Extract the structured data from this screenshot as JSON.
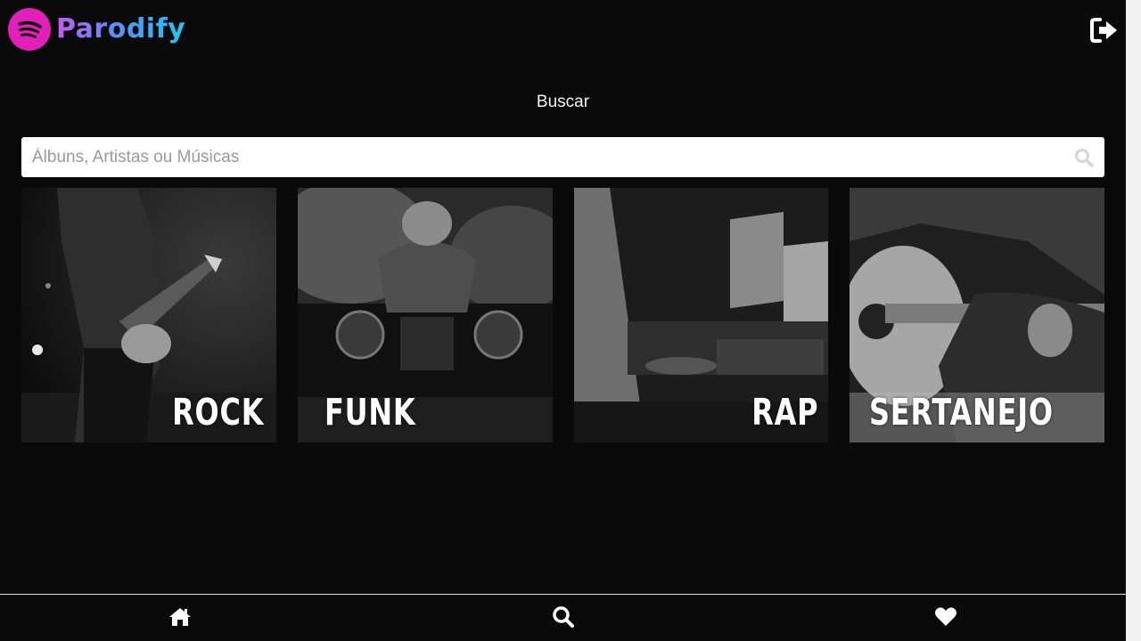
{
  "app": {
    "name": "Parodify"
  },
  "search": {
    "title": "Buscar",
    "placeholder": "Álbuns, Artistas ou Músicas",
    "value": ""
  },
  "genres": [
    {
      "label": "ROCK"
    },
    {
      "label": "FUNK"
    },
    {
      "label": "RAP"
    },
    {
      "label": "SERTANEJO"
    }
  ],
  "icons": {
    "logo": "spotify-like-icon",
    "logout": "sign-out-icon",
    "search": "search-icon",
    "home": "home-icon",
    "favorites": "heart-icon"
  },
  "colors": {
    "background": "#0a0a0a",
    "logo_mark": "#e020b8",
    "logo_gradient_start": "#c45bf0",
    "logo_gradient_end": "#1fc6f2",
    "text": "#ffffff"
  }
}
